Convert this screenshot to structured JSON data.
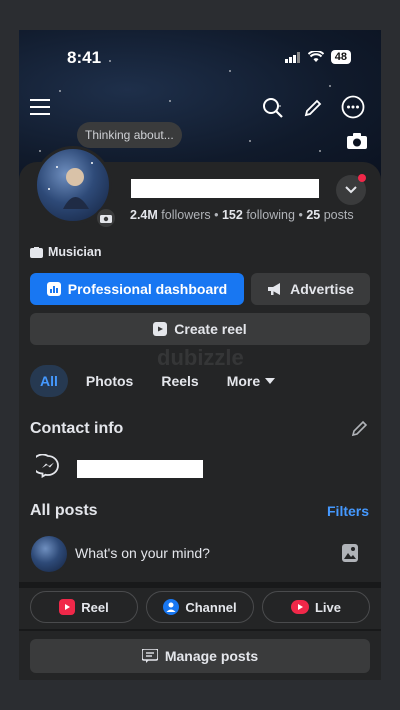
{
  "status_bar": {
    "time": "8:41",
    "battery": "48"
  },
  "header": {
    "thinking_prompt": "Thinking about..."
  },
  "profile": {
    "followers_count": "2.4M",
    "followers_label": "followers",
    "following_count": "152",
    "following_label": "following",
    "posts_count": "25",
    "posts_label": "posts",
    "separator": "•",
    "category": "Musician"
  },
  "actions": {
    "professional_dashboard": "Professional dashboard",
    "advertise": "Advertise",
    "create_reel": "Create reel"
  },
  "tabs": [
    "All",
    "Photos",
    "Reels",
    "More"
  ],
  "contact": {
    "title": "Contact info"
  },
  "posts": {
    "title": "All posts",
    "filters": "Filters",
    "composer_placeholder": "What's on your mind?"
  },
  "quick_actions": {
    "reel": "Reel",
    "channel": "Channel",
    "live": "Live"
  },
  "manage_posts": "Manage posts",
  "watermark": "dubizzle",
  "colors": {
    "accent": "#1877f2",
    "link": "#4599ff",
    "badge": "#f02849"
  }
}
